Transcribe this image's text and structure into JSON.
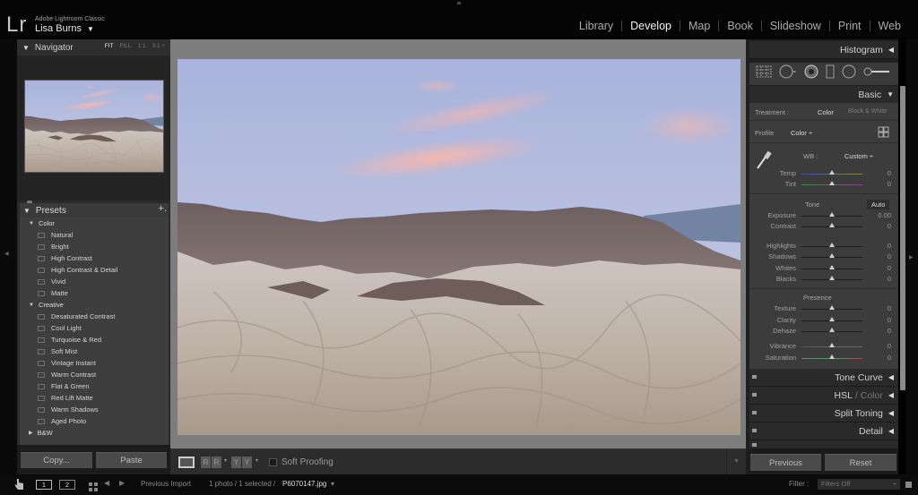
{
  "app": {
    "logo": "Lr",
    "product_name": "Adobe Lightroom Classic",
    "user": "Lisa Burns",
    "user_caret": "▼"
  },
  "modules": [
    {
      "label": "Library",
      "active": false
    },
    {
      "label": "Develop",
      "active": true
    },
    {
      "label": "Map",
      "active": false
    },
    {
      "label": "Book",
      "active": false
    },
    {
      "label": "Slideshow",
      "active": false
    },
    {
      "label": "Print",
      "active": false
    },
    {
      "label": "Web",
      "active": false
    }
  ],
  "navigator": {
    "title": "Navigator",
    "zoom_options": [
      "FIT",
      "FILL",
      "1:1",
      "3:1 ÷"
    ],
    "active_zoom": "FIT"
  },
  "presets": {
    "title": "Presets",
    "add_icon": "+.",
    "groups": [
      {
        "name": "Color",
        "expanded": true,
        "items": [
          "Natural",
          "Bright",
          "High Contrast",
          "High Contrast & Detail",
          "Vivid",
          "Matte"
        ]
      },
      {
        "name": "Creative",
        "expanded": true,
        "items": [
          "Desaturated Contrast",
          "Cool Light",
          "Turquoise & Red",
          "Soft Mist",
          "Vintage Instant",
          "Warm Contrast",
          "Flat & Green",
          "Red Lift Matte",
          "Warm Shadows",
          "Aged Photo"
        ]
      },
      {
        "name": "B&W",
        "expanded": false,
        "items": []
      }
    ]
  },
  "left_buttons": {
    "copy": "Copy...",
    "paste": "Paste"
  },
  "toolbar": {
    "compare_before_after_1": "R|R",
    "compare_before_after_2": "Y|Y",
    "soft_proofing_label": "Soft Proofing",
    "soft_proofing_checked": false
  },
  "right_panel": {
    "histogram_title": "Histogram",
    "basic_title": "Basic",
    "treatment_label": "Treatment :",
    "treatment_color": "Color",
    "treatment_bw": "Black & White",
    "profile_label": "Profile",
    "profile_value": "Color ÷",
    "wb_label": "WB :",
    "wb_value": "Custom ÷",
    "tone_label": "Tone",
    "auto_label": "Auto",
    "presence_label": "Presence",
    "sliders": {
      "wb": [
        {
          "name": "Temp",
          "value": "0",
          "position": 0.5
        },
        {
          "name": "Tint",
          "value": "0",
          "position": 0.5
        }
      ],
      "tone": [
        {
          "name": "Exposure",
          "value": "0.00",
          "position": 0.5
        },
        {
          "name": "Contrast",
          "value": "0",
          "position": 0.5
        }
      ],
      "tone2": [
        {
          "name": "Highlights",
          "value": "0",
          "position": 0.5
        },
        {
          "name": "Shadows",
          "value": "0",
          "position": 0.5
        },
        {
          "name": "Whites",
          "value": "0",
          "position": 0.5
        },
        {
          "name": "Blacks",
          "value": "0",
          "position": 0.5
        }
      ],
      "presence": [
        {
          "name": "Texture",
          "value": "0",
          "position": 0.5
        },
        {
          "name": "Clarity",
          "value": "0",
          "position": 0.5
        },
        {
          "name": "Dehaze",
          "value": "0",
          "position": 0.5
        }
      ],
      "presence2": [
        {
          "name": "Vibrance",
          "value": "0",
          "position": 0.5
        },
        {
          "name": "Saturation",
          "value": "0",
          "position": 0.5
        }
      ]
    },
    "collapsed_sections": [
      "Tone Curve",
      "HSL / Color",
      "Split Toning",
      "Detail"
    ],
    "hsl_primary": "HSL",
    "hsl_secondary": "/ Color",
    "previous_label": "Previous",
    "reset_label": "Reset"
  },
  "statusbar": {
    "page1": "1",
    "page2": "2",
    "source": "Previous Import",
    "selection": "1 photo / 1 selected /",
    "filename": "P6070147.jpg",
    "filename_caret": "▾",
    "filter_label": "Filter :",
    "filter_value": "Filters Off"
  },
  "colors": {
    "background": "#000000",
    "panel": "#3c3c3c",
    "center_bg": "#7d7d7d",
    "active_text": "#f2f2f2"
  }
}
